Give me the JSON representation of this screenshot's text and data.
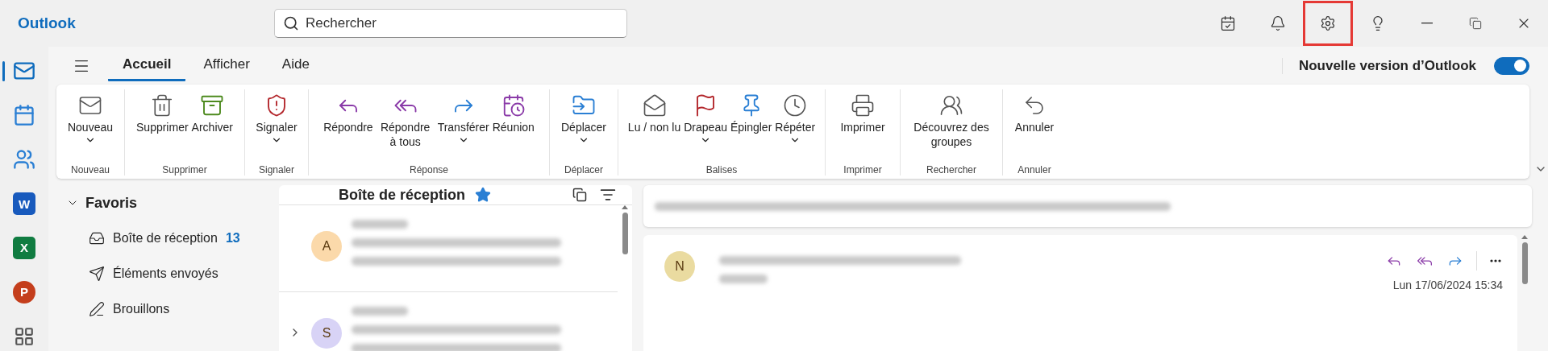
{
  "app": {
    "title": "Outlook"
  },
  "search": {
    "placeholder": "Rechercher"
  },
  "title_bar_buttons": [
    {
      "kind": "todo",
      "highlighted": false
    },
    {
      "kind": "bell",
      "highlighted": false
    },
    {
      "kind": "settings",
      "highlighted": true
    },
    {
      "kind": "tips",
      "highlighted": false
    }
  ],
  "rail": [
    {
      "kind": "mail",
      "selected": true
    },
    {
      "kind": "calendar",
      "selected": false
    },
    {
      "kind": "people",
      "selected": false
    },
    {
      "kind": "word",
      "letter": "W",
      "selected": false
    },
    {
      "kind": "excel",
      "letter": "X",
      "selected": false
    },
    {
      "kind": "powerpoint",
      "letter": "P",
      "selected": false
    },
    {
      "kind": "apps",
      "selected": false
    }
  ],
  "tabs": [
    {
      "label": "Accueil",
      "selected": true
    },
    {
      "label": "Afficher",
      "selected": false
    },
    {
      "label": "Aide",
      "selected": false
    }
  ],
  "new_version": {
    "label": "Nouvelle version d’Outlook",
    "on": true
  },
  "ribbon": [
    {
      "label": "Nouveau",
      "buttons": [
        {
          "label": "Nouveau",
          "dropdown": true
        }
      ]
    },
    {
      "label": "Supprimer",
      "buttons": [
        {
          "label": "Supprimer",
          "dropdown": false
        },
        {
          "label": "Archiver",
          "dropdown": false
        }
      ]
    },
    {
      "label": "Signaler",
      "buttons": [
        {
          "label": "Signaler",
          "dropdown": true
        }
      ]
    },
    {
      "label": "Réponse",
      "buttons": [
        {
          "label": "Répondre",
          "dropdown": false
        },
        {
          "label": "Répondre à tous",
          "dropdown": false
        },
        {
          "label": "Transférer",
          "dropdown": true
        },
        {
          "label": "Réunion",
          "dropdown": false
        }
      ]
    },
    {
      "label": "Déplacer",
      "buttons": [
        {
          "label": "Déplacer",
          "dropdown": true
        }
      ]
    },
    {
      "label": "Balises",
      "buttons": [
        {
          "label": "Lu / non lu",
          "dropdown": false
        },
        {
          "label": "Drapeau",
          "dropdown": true
        },
        {
          "label": "Épingler",
          "dropdown": false
        },
        {
          "label": "Répéter",
          "dropdown": true
        }
      ]
    },
    {
      "label": "Imprimer",
      "buttons": [
        {
          "label": "Imprimer",
          "dropdown": false
        }
      ]
    },
    {
      "label": "Rechercher",
      "buttons": [
        {
          "label": "Découvrez des groupes",
          "dropdown": false
        }
      ]
    },
    {
      "label": "Annuler",
      "buttons": [
        {
          "label": "Annuler",
          "dropdown": false
        }
      ]
    }
  ],
  "favorites": {
    "label": "Favoris",
    "expanded": true,
    "items": [
      {
        "label": "Boîte de réception",
        "count": "13"
      },
      {
        "label": "Éléments envoyés"
      },
      {
        "label": "Brouillons"
      }
    ]
  },
  "mail_list": {
    "title": "Boîte de réception",
    "favorite": true,
    "rows": [
      {
        "kind": "message",
        "initial": "A",
        "color": "#fbd9aa"
      },
      {
        "kind": "conversation",
        "initial": "S",
        "color": "#d8d3f6"
      }
    ]
  },
  "reading_pane": {
    "initial": "N",
    "color": "#eadba0",
    "date": "Lun 17/06/2024 15:34"
  }
}
